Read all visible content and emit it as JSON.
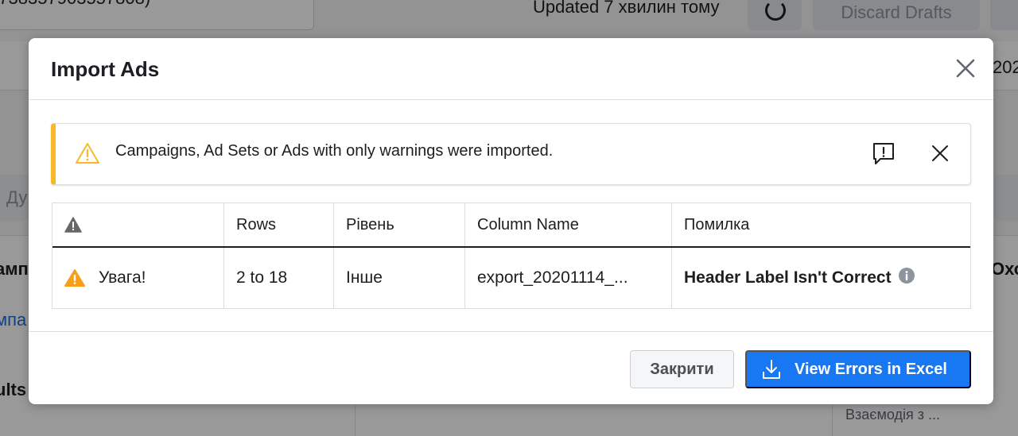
{
  "background": {
    "account_text": "(738357903557808)",
    "updated_text": "Updated 7 хвилин тому",
    "discard_label": "Discard Drafts",
    "year_fragment": "202",
    "search_fragment": "Ду",
    "campaign_fragment": "амп",
    "campaign_link_fragment": "мпа",
    "results_fragment": "ults",
    "right_fragment": "Охо",
    "engagement_text": "Взаємодія з ..."
  },
  "modal": {
    "title": "Import Ads",
    "alert": {
      "text": "Campaigns, Ad Sets or Ads with only warnings were imported.",
      "accent_color": "#f7b928"
    },
    "table": {
      "headers": [
        "",
        "Rows",
        "Рівень",
        "Column Name",
        "Помилка"
      ],
      "rows": [
        {
          "severity": "Увага!",
          "rows": "2 to 18",
          "level": "Інше",
          "column": "export_20201114_...",
          "error": "Header Label Isn't Correct"
        }
      ]
    },
    "footer": {
      "close_label": "Закрити",
      "excel_label": "View Errors in Excel"
    },
    "primary_color": "#1877f2"
  }
}
